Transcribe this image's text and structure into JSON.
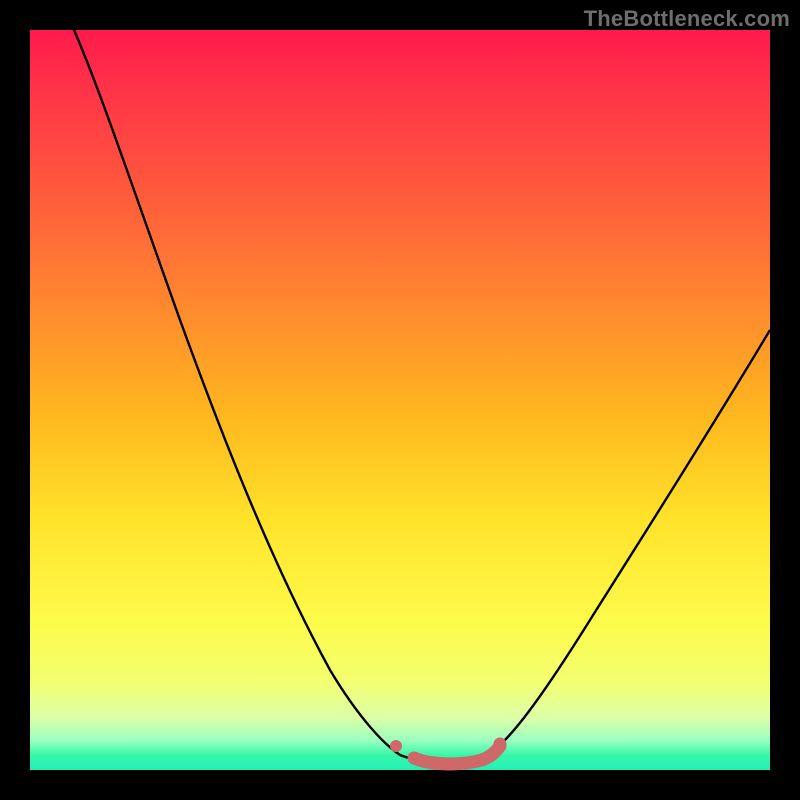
{
  "attribution": "TheBottleneck.com",
  "colors": {
    "frame": "#000000",
    "attribution_text": "#6e6e6e",
    "curve_stroke": "#000000",
    "marker_fill": "#cf6868",
    "gradient_top": "#ff1a4c",
    "gradient_bottom": "#22efb8"
  },
  "chart_data": {
    "type": "line",
    "title": "",
    "xlabel": "",
    "ylabel": "",
    "xlim": [
      0,
      100
    ],
    "ylim": [
      0,
      100
    ],
    "series": [
      {
        "name": "bottleneck-curve-left",
        "x": [
          6,
          10,
          15,
          20,
          25,
          30,
          35,
          40,
          45,
          48,
          50
        ],
        "y": [
          100,
          90,
          78,
          66,
          54,
          42,
          31,
          20,
          10,
          4,
          1
        ]
      },
      {
        "name": "valley-floor",
        "x": [
          50,
          54,
          58,
          62
        ],
        "y": [
          1,
          0.8,
          0.8,
          1
        ]
      },
      {
        "name": "bottleneck-curve-right",
        "x": [
          62,
          66,
          70,
          75,
          80,
          85,
          90,
          95,
          100
        ],
        "y": [
          1,
          5,
          10,
          18,
          27,
          36,
          45,
          54,
          62
        ]
      }
    ],
    "markers": [
      {
        "name": "left-edge-dot",
        "x": 50,
        "y": 2.5
      },
      {
        "name": "floor-start",
        "x": 52,
        "y": 1
      },
      {
        "name": "floor-mid1",
        "x": 55,
        "y": 0.8
      },
      {
        "name": "floor-mid2",
        "x": 58,
        "y": 0.9
      },
      {
        "name": "floor-end",
        "x": 61,
        "y": 1.2
      },
      {
        "name": "right-rise",
        "x": 63,
        "y": 2.2
      }
    ]
  }
}
